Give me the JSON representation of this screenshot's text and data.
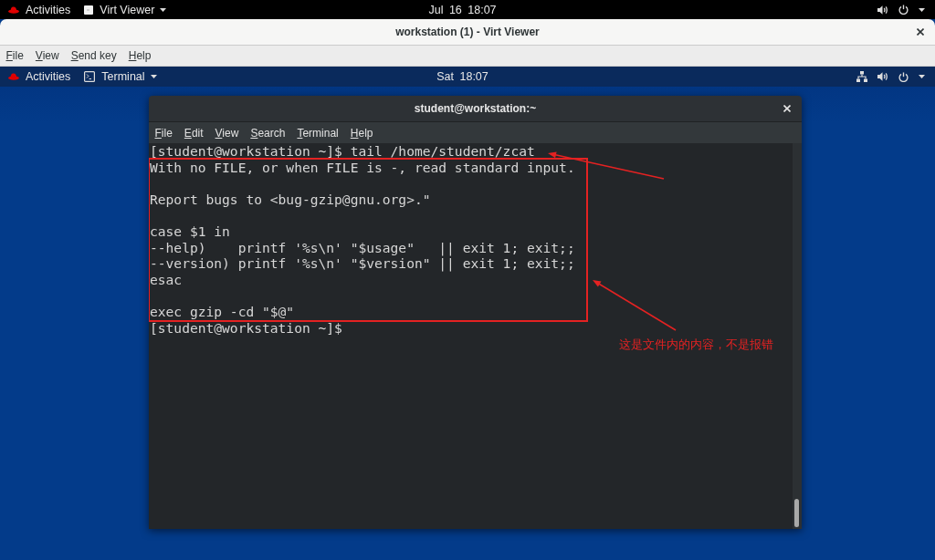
{
  "top_bar": {
    "activities": "Activities",
    "app_menu": "Virt Viewer",
    "clock": "Jul 16 18:07"
  },
  "viewer_window": {
    "title": "workstation (1) - Virt Viewer",
    "menu": [
      "File",
      "View",
      "Send key",
      "Help"
    ]
  },
  "guest_top_bar": {
    "activities": "Activities",
    "app_menu": "Terminal",
    "clock": "Sat 18:07"
  },
  "terminal": {
    "title": "student@workstation:~",
    "menu": [
      "File",
      "Edit",
      "View",
      "Search",
      "Terminal",
      "Help"
    ],
    "command_line": "[student@workstation ~]$ tail /home/student/zcat",
    "output_blocks": [
      [
        "With no FILE, or when FILE is -, read standard input."
      ],
      [
        "Report bugs to <bug-gzip@gnu.org>.\""
      ],
      [
        "case $1 in",
        "--help)    printf '%s\\n' \"$usage\"   || exit 1; exit;;",
        "--version) printf '%s\\n' \"$version\" || exit 1; exit;;",
        "esac"
      ],
      [
        "exec gzip -cd \"$@\""
      ]
    ],
    "prompt_line": "[student@workstation ~]$"
  },
  "annotation": {
    "note": "这是文件内的内容，不是报错"
  }
}
